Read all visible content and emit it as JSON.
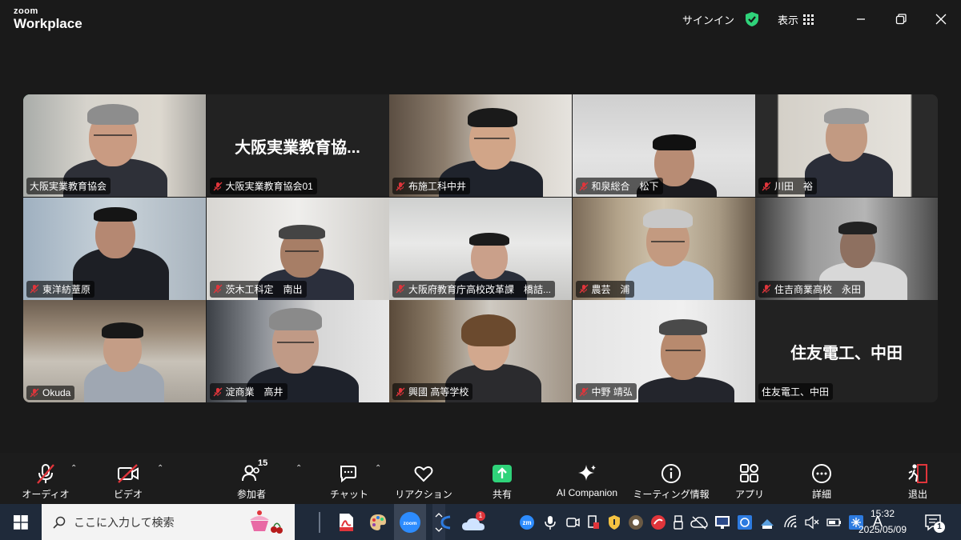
{
  "titlebar": {
    "brand": "zoom",
    "product": "Workplace",
    "signin_label": "サインイン",
    "view_label": "表示"
  },
  "participants": [
    {
      "name": "大阪実業教育協会",
      "muted": false,
      "active": true
    },
    {
      "name": "大阪実業教育協会01",
      "muted": true,
      "display_text": "大阪実業教育協..."
    },
    {
      "name": "布施工科中井",
      "muted": true
    },
    {
      "name": "和泉総合　松下",
      "muted": true
    },
    {
      "name": "川田　裕",
      "muted": true
    },
    {
      "name": "東洋紡蕫原",
      "muted": true
    },
    {
      "name": "茨木工科定　南出",
      "muted": true
    },
    {
      "name": "大阪府教育庁高校改革課　橋詰...",
      "muted": true
    },
    {
      "name": "農芸　浦",
      "muted": true
    },
    {
      "name": "住吉商業高校　永田",
      "muted": true
    },
    {
      "name": "Okuda",
      "muted": true
    },
    {
      "name": "淀商業　高井",
      "muted": true
    },
    {
      "name": "興國 高等学校",
      "muted": true
    },
    {
      "name": "中野 靖弘",
      "muted": true
    },
    {
      "name": "住友電工、中田",
      "muted": false,
      "display_text": "住友電工、中田"
    }
  ],
  "controls": {
    "audio": "オーディオ",
    "video": "ビデオ",
    "participants": "参加者",
    "participants_count": "15",
    "chat": "チャット",
    "reactions": "リアクション",
    "share": "共有",
    "ai": "AI Companion",
    "meeting_info": "ミーティング情報",
    "apps": "アプリ",
    "more": "詳細",
    "leave": "退出"
  },
  "taskbar": {
    "search_placeholder": "ここに入力して検索",
    "time": "15:32",
    "date": "2025/05/09",
    "ime": "A",
    "notification_count": "1",
    "onedrive_badge": "1"
  },
  "colors": {
    "active_speaker": "#2fd37a",
    "share_green": "#2fd37a",
    "leave_red": "#e0353b",
    "mute_red": "#e0353b"
  }
}
